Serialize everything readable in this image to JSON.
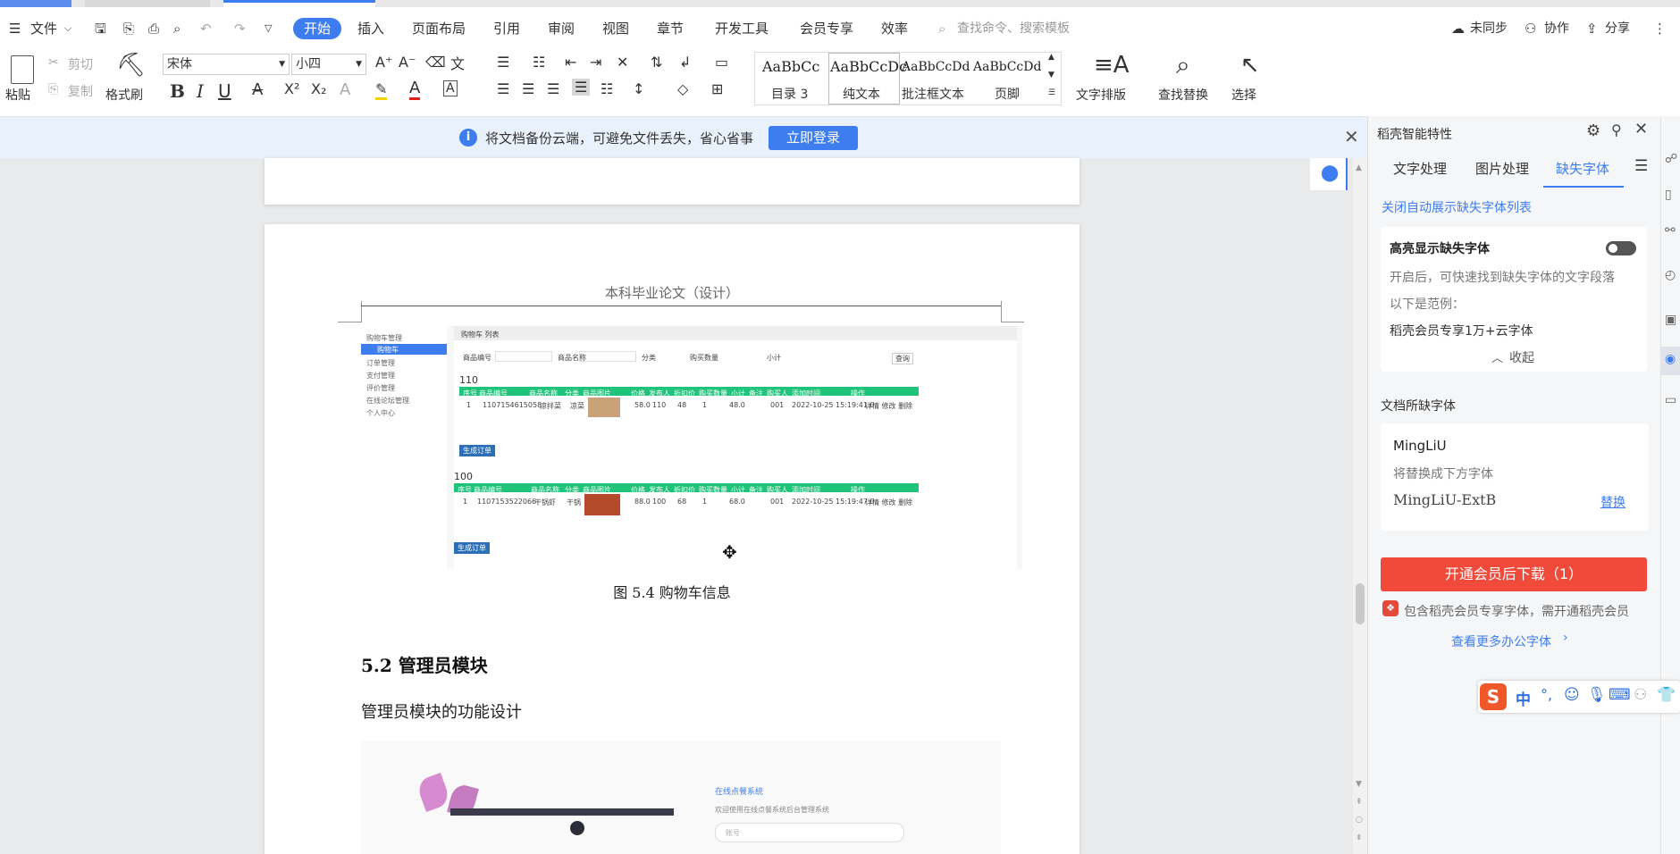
{
  "menu": {
    "file_label": "文件",
    "tabs": [
      "开始",
      "插入",
      "页面布局",
      "引用",
      "审阅",
      "视图",
      "章节",
      "开发工具",
      "会员专享",
      "效率"
    ],
    "search_placeholder": "查找命令、搜索模板",
    "sync_label": "未同步",
    "collab_label": "协作",
    "share_label": "分享"
  },
  "toolbar": {
    "paste": "粘贴",
    "cut": "剪切",
    "copy": "复制",
    "format_painter": "格式刷",
    "font_name": "宋体",
    "font_size": "小四",
    "text_layout": "文字排版",
    "find_replace": "查找替换",
    "select": "选择",
    "styles": [
      {
        "preview": "AaBbCc",
        "label": "目录 3"
      },
      {
        "preview": "AaBbCcDc",
        "label": "纯文本"
      },
      {
        "preview": "AaBbCcDd",
        "label": "批注框文本"
      },
      {
        "preview": "AaBbCcDd",
        "label": "页脚"
      }
    ]
  },
  "notify": {
    "message": "将文档备份云端，可避免文件丢失，省心省事",
    "login_button": "立即登录"
  },
  "doc": {
    "header_text": "本科毕业论文（设计）",
    "figure_caption": "图 5.4  购物车信息",
    "section_heading": "5.2  管理员模块",
    "section_body": "管理员模块的功能设计",
    "shot1": {
      "title": "购物车 列表",
      "sidebar": [
        "购物车管理",
        "购物车",
        "订单管理",
        "支付管理",
        "评价管理",
        "在线论坛管理",
        "个人中心"
      ],
      "filter_labels": [
        "商品编号",
        "商品名称",
        "分类",
        "购买数量",
        "小计",
        "查询"
      ],
      "group1": "110",
      "group2": "100",
      "header": [
        "序号",
        "商品编号",
        "商品名称",
        "分类",
        "商品图片",
        "价格",
        "发布人",
        "折扣价",
        "购买数量",
        "小计",
        "备注",
        "购买人",
        "添加时间",
        "操作"
      ],
      "row1": [
        "1",
        "1107154615058",
        "凉拌菜",
        "凉菜",
        "",
        "58.0",
        "110",
        "48",
        "1",
        "48.0",
        "",
        "001",
        "2022-10-25 15:19:41.0",
        "详情 修改 删除"
      ],
      "row2": [
        "1",
        "1107153522066",
        "干锅虾",
        "干锅",
        "",
        "88.0",
        "100",
        "68",
        "1",
        "68.0",
        "",
        "001",
        "2022-10-25 15:19:47.0",
        "详情 修改 删除"
      ],
      "generate_order": "生成订单"
    },
    "shot2": {
      "system_name": "在线点餐系统",
      "welcome": "欢迎使用在线点餐系统后台管理系统",
      "account_placeholder": "账号"
    }
  },
  "panel": {
    "title": "稻壳智能特性",
    "tabs": [
      "文字处理",
      "图片处理",
      "缺失字体"
    ],
    "close_auto_link": "关闭自动展示缺失字体列表",
    "highlight_title": "高亮显示缺失字体",
    "highlight_desc": "开启后，可快速找到缺失字体的文字段落",
    "example_label": "以下是范例：",
    "example_text": "稻壳会员专享1万+云字体",
    "collapse": "收起",
    "missing_title": "文档所缺字体",
    "missing_font": "MingLiU",
    "replace_hint": "将替换成下方字体",
    "replacement_font": "MingLiU-ExtB",
    "replace_link": "替换",
    "download_button": "开通会员后下载（1）",
    "member_note": "包含稻壳会员专享字体，需开通稻壳会员",
    "more_fonts": "查看更多办公字体"
  },
  "ime": {
    "mode": "中"
  },
  "colors": {
    "accent": "#3d7df0",
    "download_button": "#f04a3b",
    "table_header": "#1fc37a"
  }
}
